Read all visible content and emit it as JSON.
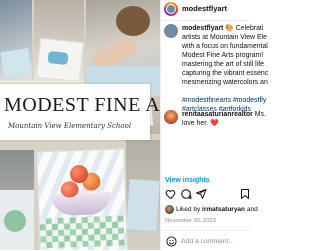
{
  "post": {
    "account_handle": "modestflyart",
    "caption_lines": [
      {
        "parts": [
          {
            "text": "modestflyart",
            "style": "bold"
          },
          {
            "text": " 🎨 Celebrati",
            "style": "normal"
          }
        ]
      },
      {
        "parts": [
          {
            "text": "artists at Mountain View Ele",
            "style": "normal"
          }
        ]
      },
      {
        "parts": [
          {
            "text": "with a focus on fundamental",
            "style": "normal"
          }
        ]
      },
      {
        "parts": [
          {
            "text": "Modest Fine Arts program! ",
            "style": "normal"
          }
        ]
      },
      {
        "parts": [
          {
            "text": "mastering the art of still life",
            "style": "normal"
          }
        ]
      },
      {
        "parts": [
          {
            "text": "capturing the vibrant essenc",
            "style": "normal"
          }
        ]
      },
      {
        "parts": [
          {
            "text": "mesmerizing watercolors an",
            "style": "normal"
          }
        ]
      },
      {
        "parts": [
          {
            "text": "",
            "style": "normal"
          }
        ]
      },
      {
        "parts": [
          {
            "text": "#modestfinearts #modestfly",
            "style": "tag"
          }
        ]
      },
      {
        "parts": [
          {
            "text": "#artclasses #artforkids",
            "style": "tag"
          }
        ]
      }
    ],
    "comment": {
      "author": "renitaasaturianrealtor",
      "text_prefix": " Ms.",
      "line2": "love her. ",
      "heart": "❤️"
    },
    "view_insights_label": "View insights",
    "liked_by": {
      "prefix": "Liked by ",
      "user": "irmatsaturyan",
      "suffix": " and"
    },
    "date": "November 30, 2023",
    "add_comment_placeholder": "Add a comment..."
  },
  "media": {
    "banner_title": "MODEST FINE ART",
    "banner_subtitle": "Mountain View Elementary School"
  },
  "icons": {
    "like": "heart-icon",
    "comment": "comment-icon",
    "share": "share-icon",
    "save": "bookmark-icon",
    "emoji": "emoji-icon"
  },
  "colors": {
    "link_blue": "#0095f6",
    "hashtag_blue": "#00376b",
    "meta_gray": "#8e8e8e"
  }
}
